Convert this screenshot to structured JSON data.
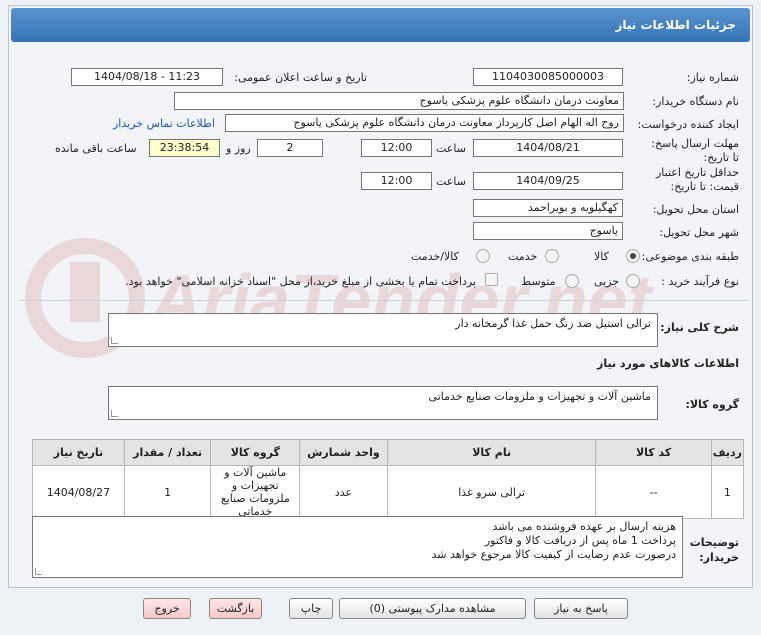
{
  "header": {
    "title": "جزئیات اطلاعات نیاز"
  },
  "form": {
    "need_number_label": "شماره نیاز:",
    "need_number": "1104030085000003",
    "announce_label": "تاریخ و ساعت اعلان عمومی:",
    "announce_value": "1404/08/18 - 11:23",
    "buyer_org_label": "نام دستگاه خریدار:",
    "buyer_org": "معاونت درمان دانشگاه علوم پزشکی یاسوج",
    "requester_label": "ایجاد کننده درخواست:",
    "requester": "روح اله الهام اصل کارپرداز معاونت درمان دانشگاه علوم پزشکی یاسوج",
    "contact_link": "اطلاعات تماس خریدار",
    "reply_deadline_label": "مهلت ارسال پاسخ: تا تاریخ:",
    "reply_date": "1404/08/21",
    "time_label": "ساعت",
    "reply_time": "12:00",
    "days_value": "2",
    "days_label": "روز و",
    "remaining_time": "23:38:54",
    "remaining_label": "ساعت باقی مانده",
    "validity_label": "حداقل تاریخ اعتبار قیمت: تا تاریخ:",
    "validity_date": "1404/09/25",
    "validity_time_label": "ساعت",
    "validity_time": "12:00",
    "province_label": "استان محل تحویل:",
    "province": "کهگیلویه و بویراحمد",
    "city_label": "شهر محل تحویل:",
    "city": "یاسوج",
    "category_label": "طبقه بندی موضوعی:",
    "category_options": [
      "کالا",
      "خدمت",
      "کالا/خدمت"
    ],
    "category_selected": 0,
    "process_label": "نوع فرآیند خرید :",
    "process_options": [
      "جزیی",
      "متوسط"
    ],
    "payment_note": "پرداخت تمام یا بخشی از مبلغ خرید،از محل \"اسناد خزانه اسلامی\" خواهد بود."
  },
  "summary": {
    "label": "شرح کلی نیاز:",
    "value": "ترالی استیل ضد زنگ حمل غذا گرمخانه دار"
  },
  "goods_info_title": "اطلاعات کالاهای مورد نیاز",
  "goods_group": {
    "label": "گروه کالا:",
    "value": "ماشین آلات و تجهیزات و ملزومات صنایع خدماتی"
  },
  "table": {
    "headers": [
      "ردیف",
      "کد کالا",
      "نام کالا",
      "واحد شمارش",
      "گروه کالا",
      "تعداد / مقدار",
      "تاریخ نیاز"
    ],
    "rows": [
      [
        "1",
        "--",
        "ترالی سرو غذا",
        "عدد",
        "ماشین آلات و تجهیزات و ملزومات صنایع خدماتی",
        "1",
        "1404/08/27"
      ]
    ]
  },
  "buyer_notes": {
    "label": "توضیحات خریدار:",
    "lines": [
      "هزینه ارسال بر عهده فروشنده می باشد",
      "پرداخت 1 ماه پس از دریافت کالا و فاکتور",
      "درصورت عدم رضایت از کیفیت کالا مرجوع خواهد شد"
    ]
  },
  "buttons": {
    "reply": "پاسخ به نیاز",
    "view_docs": "مشاهده مدارک پیوستی (0)",
    "print": "چاپ",
    "back": "بازگشت",
    "exit": "خروج"
  },
  "watermark": {
    "text": "AriaTender.net",
    "color": "#e8c9c9"
  }
}
